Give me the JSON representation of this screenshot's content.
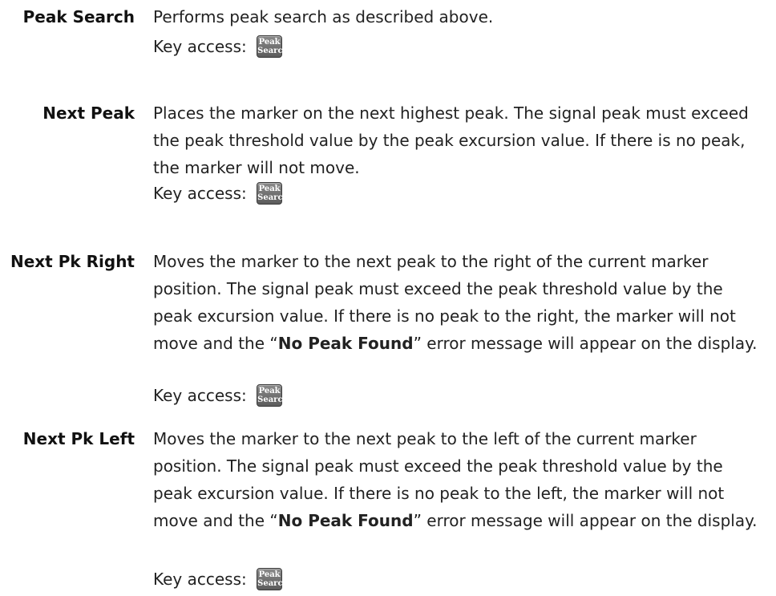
{
  "entries": [
    {
      "term": "Peak Search",
      "description": "Performs peak search as described above.",
      "key_access_label": "Key access:",
      "key_line1": "Peak",
      "key_line2": "Search"
    },
    {
      "term": "Next Peak",
      "description": "Places the marker on the next highest peak. The signal peak must exceed the peak threshold value by the peak excursion value. If there is no peak, the marker will not move.",
      "key_access_label": "Key access:",
      "key_line1": "Peak",
      "key_line2": "Search"
    },
    {
      "term": "Next Pk Right",
      "description_before": "Moves the marker to the next peak to the right of the current marker position. The signal peak must exceed the peak threshold value by the peak excursion value. If there is no peak to the right, the marker will not move and the “",
      "message": "No Peak Found",
      "description_after": "” error message will appear on the display.",
      "key_access_label": "Key access:",
      "key_line1": "Peak",
      "key_line2": "Search"
    },
    {
      "term": "Next Pk Left",
      "description_before": "Moves the marker to the next peak to the left of the current marker position. The signal peak must exceed the peak threshold value by the peak excursion value. If there is no peak to the left, the marker will not move and the “",
      "message": "No Peak Found",
      "description_after": "” error message will appear on the display.",
      "key_access_label": "Key access:",
      "key_line1": "Peak",
      "key_line2": "Search"
    }
  ]
}
